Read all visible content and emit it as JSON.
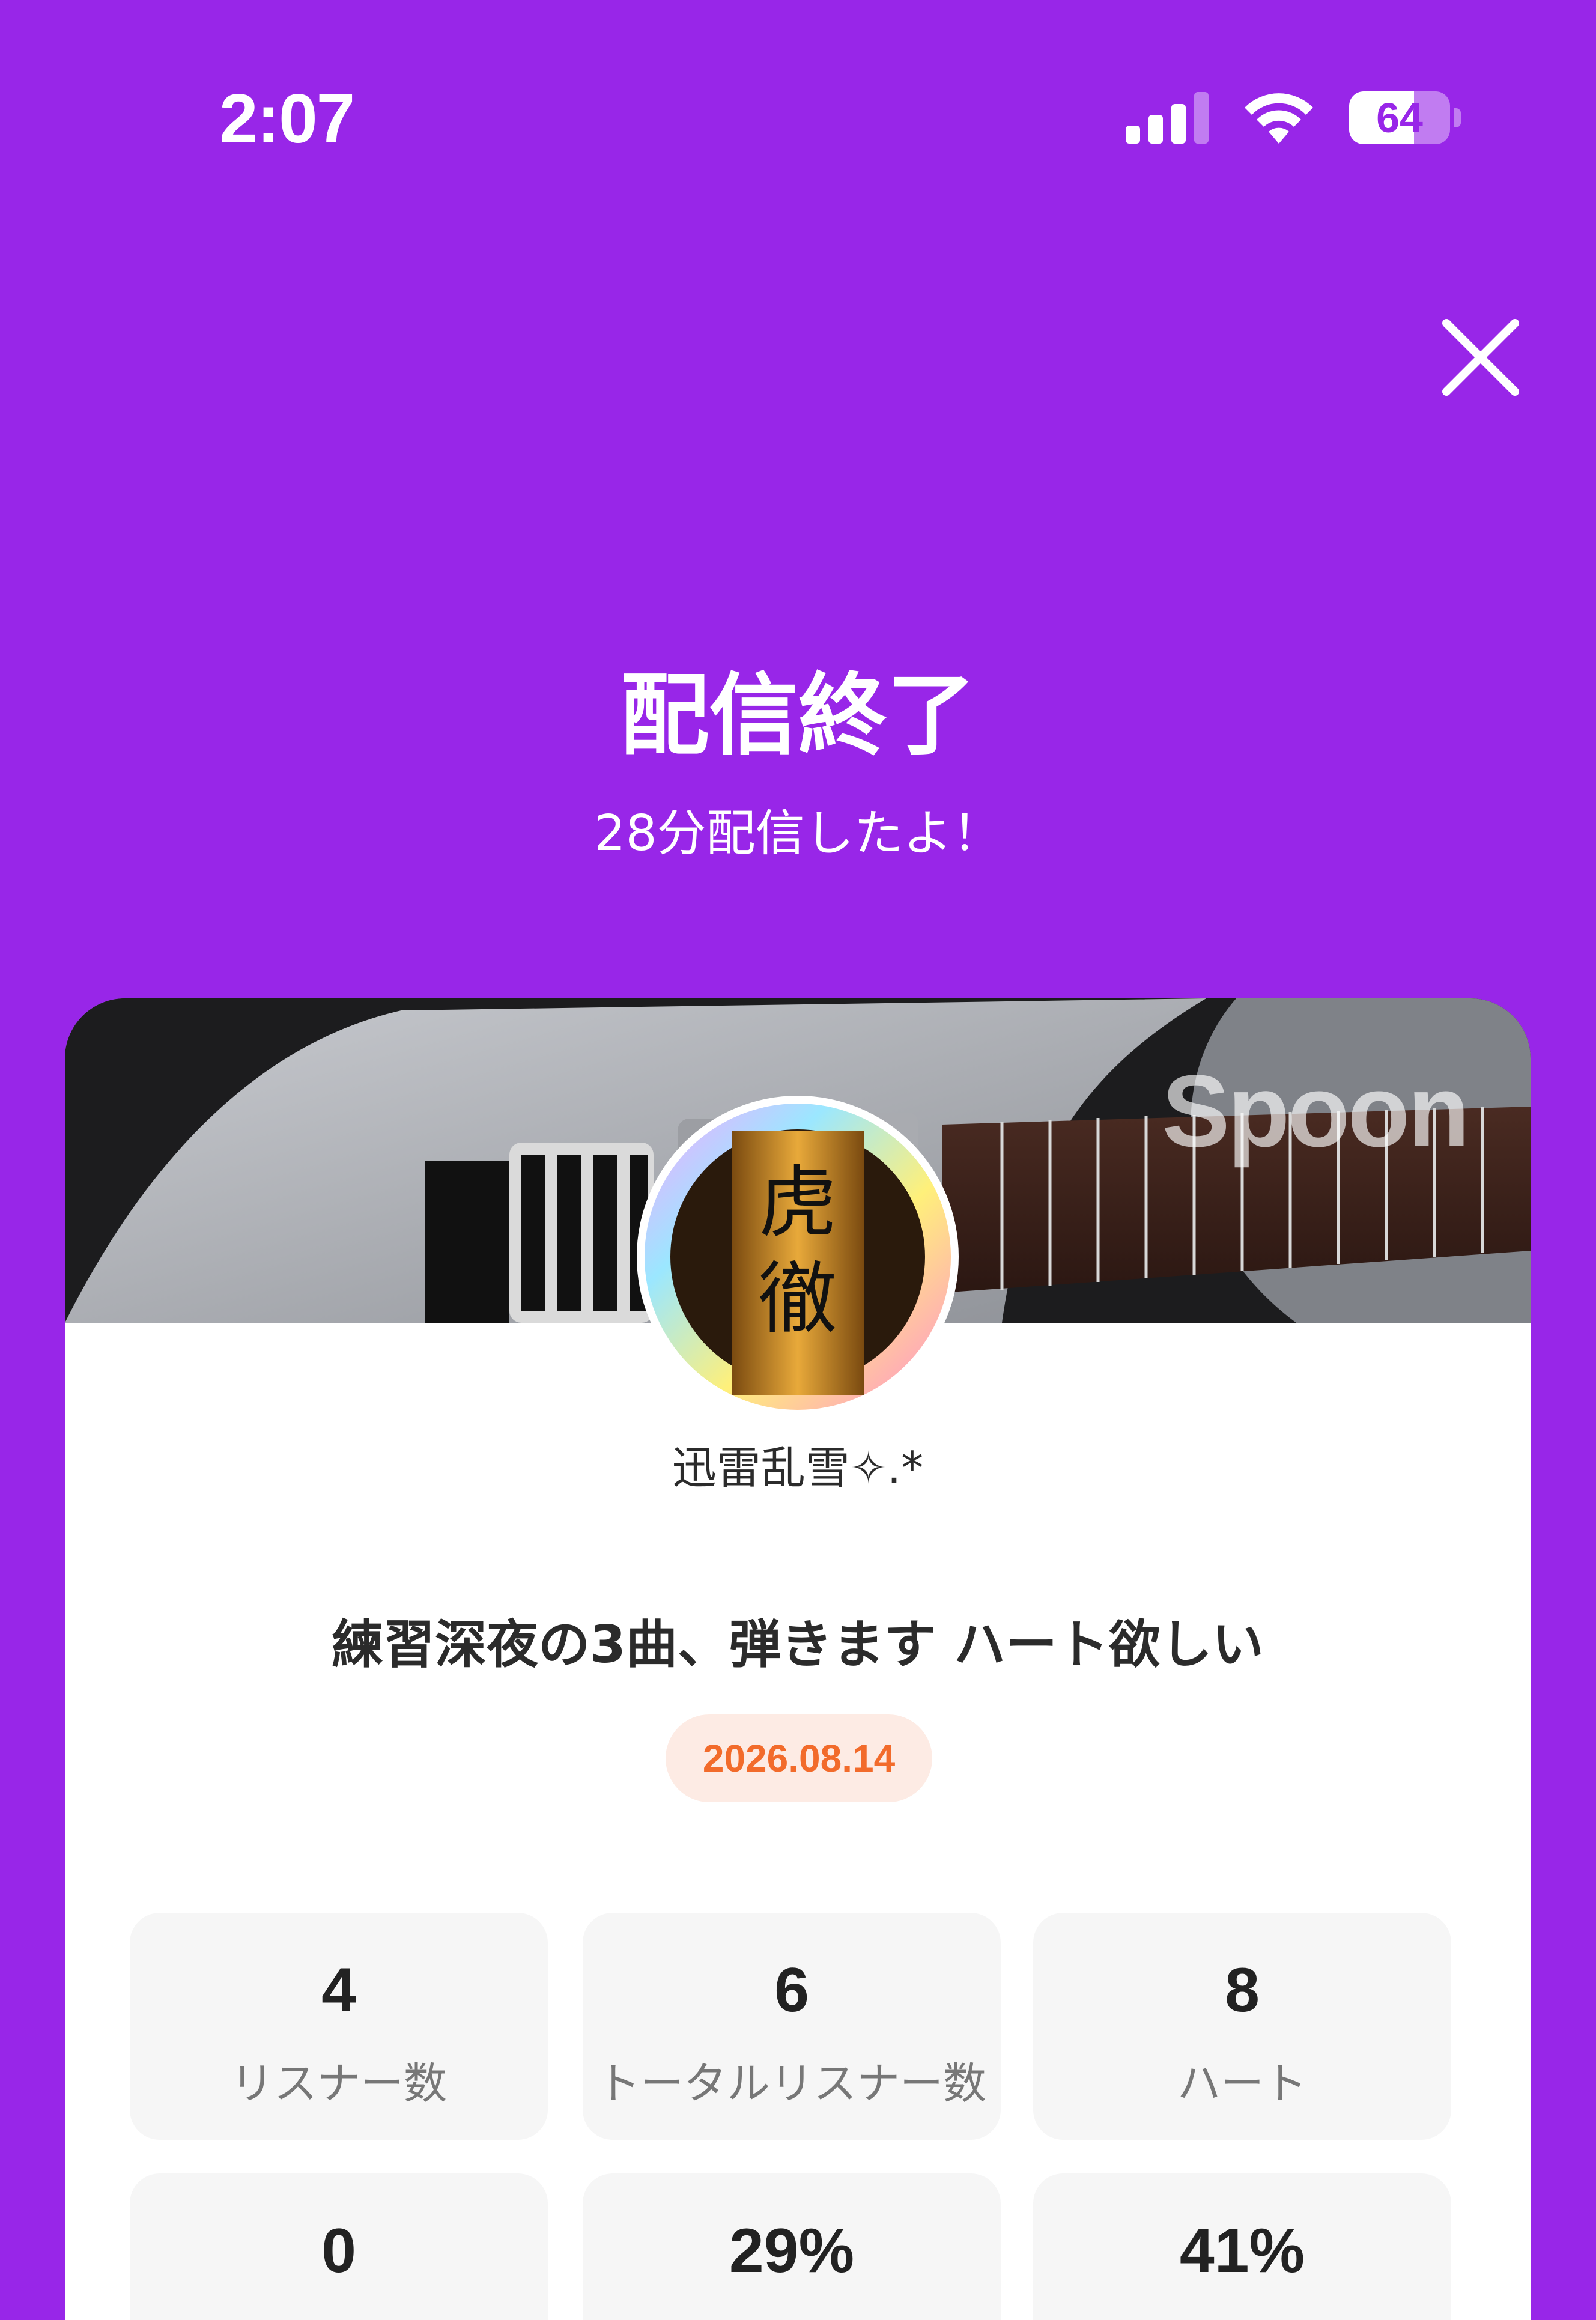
{
  "status_bar": {
    "time": "2:07",
    "battery": "64",
    "battery_level": 0.64
  },
  "header": {
    "title": "配信終了",
    "subtitle": "28分配信したよ！"
  },
  "card": {
    "banner_logo": "Spoon",
    "username": "迅雷乱雪✧.*",
    "stream_title": "練習深夜の3曲、弾きます ハート欲しい",
    "date": "2026.08.14",
    "stats": [
      {
        "value": "4",
        "label": "リスナー数"
      },
      {
        "value": "6",
        "label": "トータルリスナー数"
      },
      {
        "value": "8",
        "label": "ハート"
      },
      {
        "value": "0",
        "label": ""
      },
      {
        "value": "29%",
        "label": ""
      },
      {
        "value": "41%",
        "label": ""
      }
    ]
  },
  "colors": {
    "background": "#9826E8",
    "date_text": "#F26B2B",
    "date_bg": "#FDEBE4"
  },
  "icons": [
    "cellular-signal-icon",
    "wifi-icon",
    "battery-icon",
    "close-icon"
  ]
}
